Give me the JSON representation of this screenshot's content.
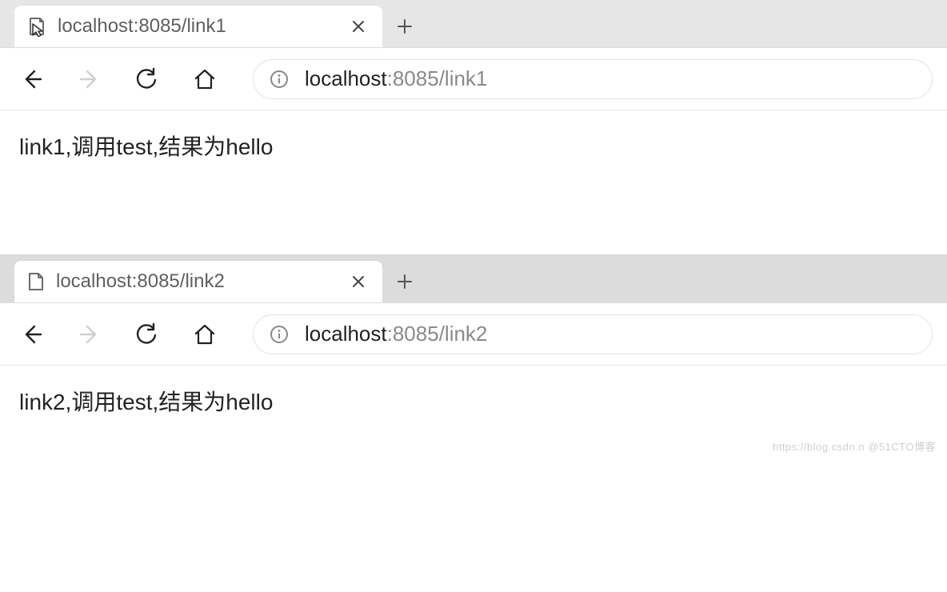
{
  "windows": [
    {
      "tab": {
        "title": "localhost:8085/link1",
        "favicon": "page-cursor-icon"
      },
      "address": {
        "host": "localhost",
        "rest": ":8085/link1"
      },
      "forward_disabled": true,
      "content": "link1,调用test,结果为hello"
    },
    {
      "tab": {
        "title": "localhost:8085/link2",
        "favicon": "page-icon"
      },
      "address": {
        "host": "localhost",
        "rest": ":8085/link2"
      },
      "forward_disabled": true,
      "content": "link2,调用test,结果为hello"
    }
  ],
  "watermark": "https://blog.csdn.n @51CTO博客"
}
